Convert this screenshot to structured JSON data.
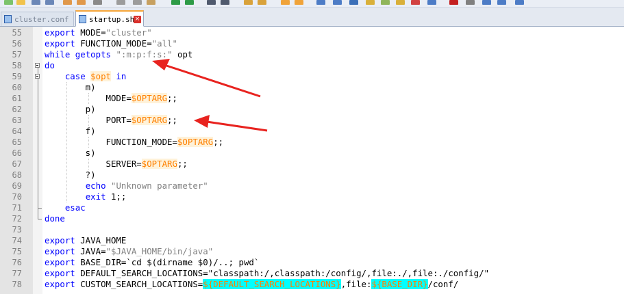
{
  "tabs": [
    {
      "label": "cluster.conf",
      "active": false,
      "close_icon": "×"
    },
    {
      "label": "startup.sh",
      "active": true,
      "close_icon": "×"
    }
  ],
  "lines": [
    {
      "num": "55",
      "segments": [
        {
          "t": "export",
          "c": "kw"
        },
        {
          "t": " MODE=",
          "c": ""
        },
        {
          "t": "\"cluster\"",
          "c": "str"
        }
      ]
    },
    {
      "num": "56",
      "segments": [
        {
          "t": "export",
          "c": "kw"
        },
        {
          "t": " FUNCTION_MODE=",
          "c": ""
        },
        {
          "t": "\"all\"",
          "c": "str"
        }
      ]
    },
    {
      "num": "57",
      "segments": [
        {
          "t": "while",
          "c": "kw"
        },
        {
          "t": " ",
          "c": ""
        },
        {
          "t": "getopts",
          "c": "kw"
        },
        {
          "t": " ",
          "c": ""
        },
        {
          "t": "\":m:p:f:s:\"",
          "c": "str"
        },
        {
          "t": " opt",
          "c": ""
        }
      ]
    },
    {
      "num": "58",
      "segments": [
        {
          "t": "do",
          "c": "kw"
        }
      ]
    },
    {
      "num": "59",
      "segments": [
        {
          "t": "    ",
          "c": ""
        },
        {
          "t": "case",
          "c": "kw"
        },
        {
          "t": " ",
          "c": ""
        },
        {
          "t": "$opt",
          "c": "var"
        },
        {
          "t": " ",
          "c": ""
        },
        {
          "t": "in",
          "c": "kw"
        }
      ]
    },
    {
      "num": "60",
      "segments": [
        {
          "t": "        m)",
          "c": ""
        }
      ]
    },
    {
      "num": "61",
      "segments": [
        {
          "t": "            MODE=",
          "c": ""
        },
        {
          "t": "$OPTARG",
          "c": "var"
        },
        {
          "t": ";;",
          "c": ""
        }
      ]
    },
    {
      "num": "62",
      "segments": [
        {
          "t": "        p)",
          "c": ""
        }
      ]
    },
    {
      "num": "63",
      "segments": [
        {
          "t": "            PORT=",
          "c": ""
        },
        {
          "t": "$OPTARG",
          "c": "var"
        },
        {
          "t": ";;",
          "c": ""
        }
      ]
    },
    {
      "num": "64",
      "segments": [
        {
          "t": "        f)",
          "c": ""
        }
      ]
    },
    {
      "num": "65",
      "segments": [
        {
          "t": "            FUNCTION_MODE=",
          "c": ""
        },
        {
          "t": "$OPTARG",
          "c": "var"
        },
        {
          "t": ";;",
          "c": ""
        }
      ]
    },
    {
      "num": "66",
      "segments": [
        {
          "t": "        s)",
          "c": ""
        }
      ]
    },
    {
      "num": "67",
      "segments": [
        {
          "t": "            SERVER=",
          "c": ""
        },
        {
          "t": "$OPTARG",
          "c": "var"
        },
        {
          "t": ";;",
          "c": ""
        }
      ]
    },
    {
      "num": "68",
      "segments": [
        {
          "t": "        ?)",
          "c": ""
        }
      ]
    },
    {
      "num": "69",
      "segments": [
        {
          "t": "        ",
          "c": ""
        },
        {
          "t": "echo",
          "c": "kw"
        },
        {
          "t": " ",
          "c": ""
        },
        {
          "t": "\"Unknown parameter\"",
          "c": "str"
        }
      ]
    },
    {
      "num": "70",
      "segments": [
        {
          "t": "        ",
          "c": ""
        },
        {
          "t": "exit",
          "c": "kw"
        },
        {
          "t": " 1;;",
          "c": ""
        }
      ]
    },
    {
      "num": "71",
      "segments": [
        {
          "t": "    ",
          "c": ""
        },
        {
          "t": "esac",
          "c": "kw"
        }
      ]
    },
    {
      "num": "72",
      "segments": [
        {
          "t": "done",
          "c": "kw"
        }
      ]
    },
    {
      "num": "73",
      "segments": []
    },
    {
      "num": "74",
      "segments": [
        {
          "t": "export",
          "c": "kw"
        },
        {
          "t": " JAVA_HOME",
          "c": ""
        }
      ]
    },
    {
      "num": "75",
      "segments": [
        {
          "t": "export",
          "c": "kw"
        },
        {
          "t": " JAVA=",
          "c": ""
        },
        {
          "t": "\"$JAVA_HOME/bin/java\"",
          "c": "str"
        }
      ]
    },
    {
      "num": "76",
      "segments": [
        {
          "t": "export",
          "c": "kw"
        },
        {
          "t": " BASE_DIR=",
          "c": ""
        },
        {
          "t": "`cd $(dirname $0)/..; pwd`",
          "c": ""
        }
      ]
    },
    {
      "num": "77",
      "segments": [
        {
          "t": "export",
          "c": "kw"
        },
        {
          "t": " DEFAULT_SEARCH_LOCATIONS=",
          "c": ""
        },
        {
          "t": "\"classpath:/,classpath:/config/,file:./,file:./config/\"",
          "c": ""
        }
      ]
    },
    {
      "num": "78",
      "segments": [
        {
          "t": "export",
          "c": "kw"
        },
        {
          "t": " CUSTOM_SEARCH_LOCATIONS=",
          "c": ""
        },
        {
          "t": "${DEFAULT_SEARCH_LOCATIONS}",
          "c": "var-hl"
        },
        {
          "t": ",file:",
          "c": ""
        },
        {
          "t": "${BASE_DIR}",
          "c": "var-hl"
        },
        {
          "t": "/conf/",
          "c": ""
        }
      ]
    }
  ],
  "colors": {
    "keyword": "#0000ff",
    "string": "#808080",
    "variable": "#ff8000",
    "highlight": "#00ffff",
    "active_tab_accent": "#f7a63a",
    "arrow": "#e8231f"
  },
  "icons": {
    "file_icon": "file-icon",
    "close_icon": "close-icon",
    "fold_marker": "fold-minus-icon"
  }
}
